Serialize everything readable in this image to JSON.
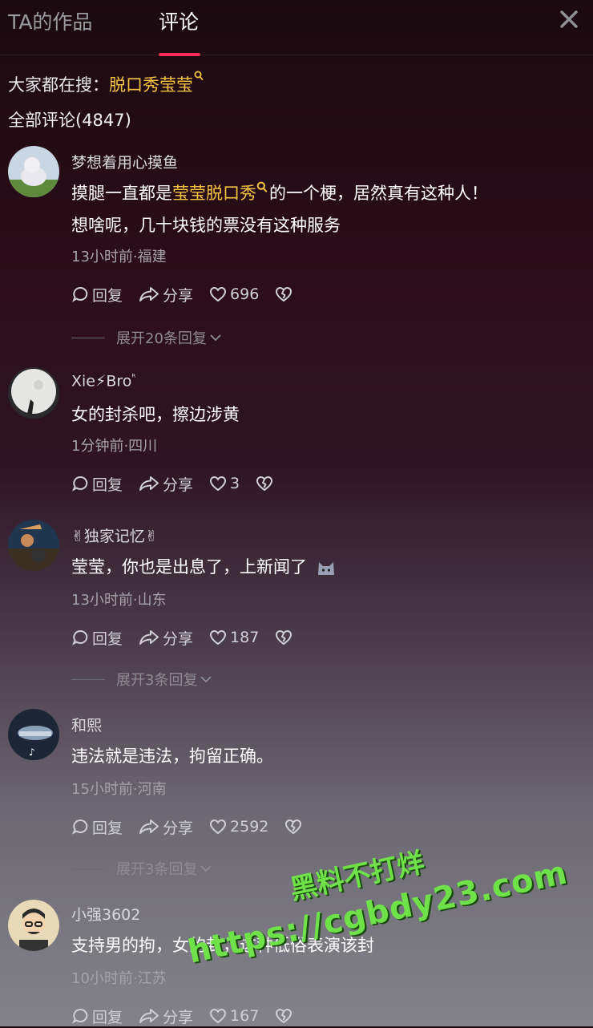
{
  "header": {
    "tab_works": "TA的作品",
    "tab_comments": "评论",
    "accent": "#fe2c55"
  },
  "search": {
    "prefix": "大家都在搜：",
    "keyword": "脱口秀莹莹",
    "keyword_color": "#f5c342"
  },
  "all_comments": "全部评论(4847)",
  "actions": {
    "reply": "回复",
    "share": "分享"
  },
  "comments": [
    {
      "username": "梦想着用心摸鱼",
      "text_pre": "摸腿一直都是",
      "text_kw": "莹莹脱口秀",
      "text_post": "的一个梗，居然真有这种人！",
      "text_line2": "想啥呢，几十块钱的票没有这种服务",
      "meta": "13小时前·福建",
      "likes": "696",
      "expand": "展开20条回复"
    },
    {
      "username": "Xie⚡Bro",
      "username_sup": "ᴿ",
      "text": "女的封杀吧，擦边涉黄",
      "meta": "1分钟前·四川",
      "likes": "3"
    },
    {
      "username": "✌独家记忆✌",
      "text": "莹莹，你也是出息了，上新闻了",
      "meta": "13小时前·山东",
      "likes": "187",
      "expand": "展开3条回复"
    },
    {
      "username": "和熙",
      "text": "违法就是违法，拘留正确。",
      "meta": "15小时前·河南",
      "likes": "2592",
      "expand": "展开3条回复"
    },
    {
      "username": "小强3602",
      "text": "支持男的拘，女的封，这种低俗表演该封",
      "meta": "10小时前·江苏",
      "likes": "167"
    }
  ],
  "watermark": {
    "line1": "黑料不打烊",
    "line2": "https://cgbdy23.com"
  }
}
